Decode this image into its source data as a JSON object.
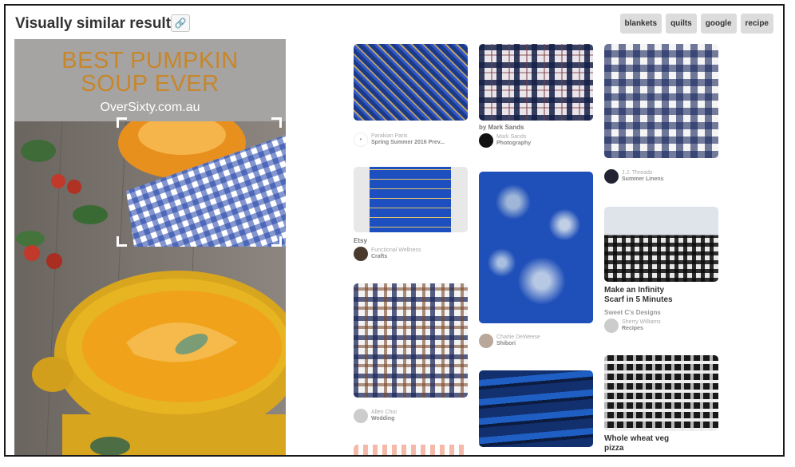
{
  "header": {
    "title": "Visually similar results",
    "link_icon": "link-icon"
  },
  "tags": [
    "blankets",
    "quilts",
    "google",
    "recipe"
  ],
  "source_image": {
    "headline_line1": "BEST PUMPKIN",
    "headline_line2": "SOUP EVER",
    "site": "OverSixty.com.au"
  },
  "results": [
    {
      "pinner_line1": "Parakian Paris",
      "pinner_line2": "Spring Summer 2016 Prev..."
    },
    {
      "source": "by Mark Sands",
      "pinner_line1": "Mark Sands",
      "pinner_line2": "Photography"
    },
    {
      "pinner_line1": "J.J. Threads",
      "pinner_line2": "Summer Linens"
    },
    {
      "source": "Etsy",
      "pinner_line1": "Functional Wellness",
      "pinner_line2": "Crafts"
    },
    {
      "pinner_line1": "Charlie DeWeese",
      "pinner_line2": "Shibori"
    },
    {
      "title": "Make an Infinity Scarf in 5 Minutes",
      "source": "Sweet C's Designs",
      "pinner_line1": "Sherry Williams",
      "pinner_line2": "Recipes"
    },
    {
      "pinner_line1": "Allen Choi",
      "pinner_line2": "Wedding"
    },
    {
      "title": "Whole wheat veg pizza"
    }
  ]
}
